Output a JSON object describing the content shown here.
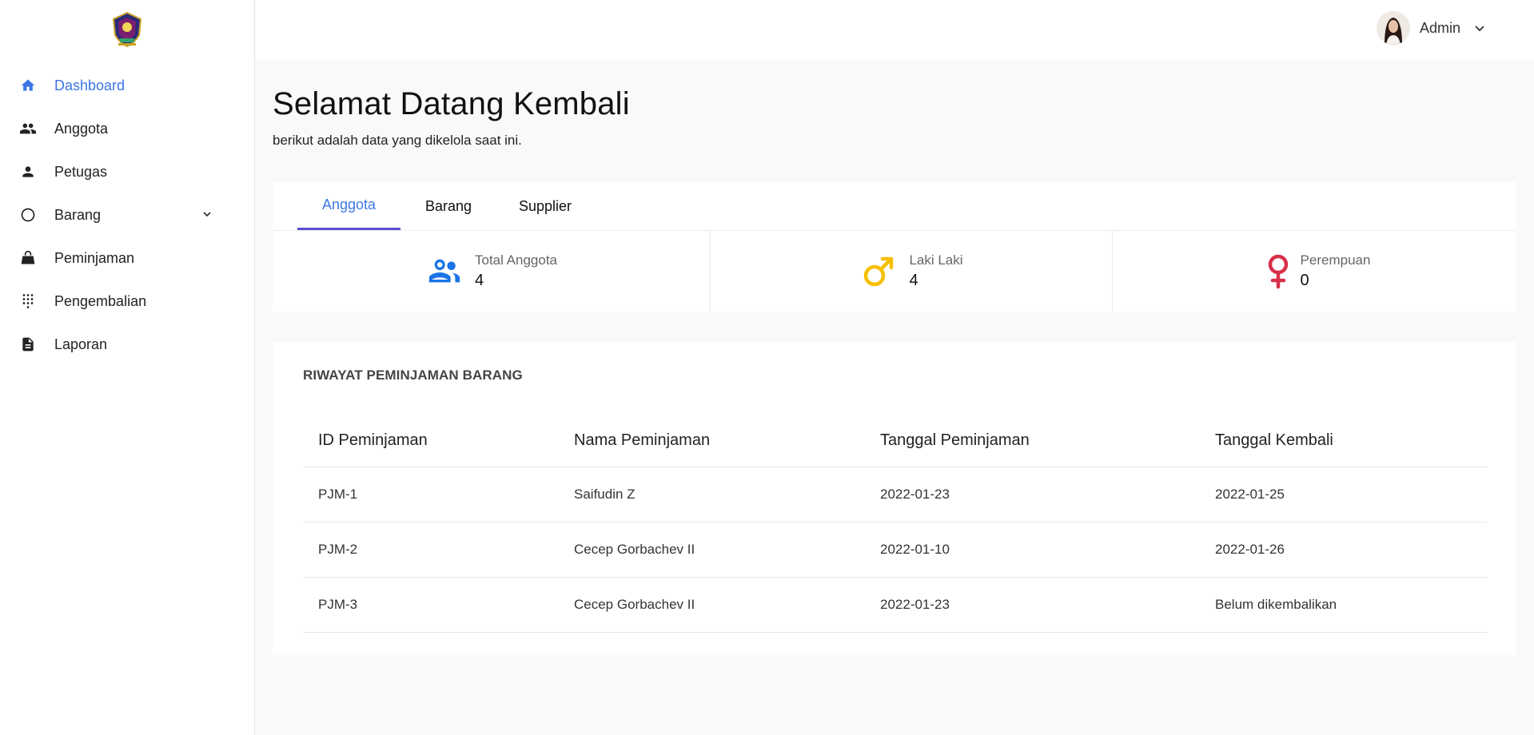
{
  "sidebar": {
    "logo_name": "institution-crest-logo",
    "items": [
      {
        "label": "Dashboard",
        "icon": "home-icon",
        "active": true
      },
      {
        "label": "Anggota",
        "icon": "people-icon"
      },
      {
        "label": "Petugas",
        "icon": "person-icon"
      },
      {
        "label": "Barang",
        "icon": "circle-icon",
        "expandable": true
      },
      {
        "label": "Peminjaman",
        "icon": "bag-icon"
      },
      {
        "label": "Pengembalian",
        "icon": "dial-pad-icon"
      },
      {
        "label": "Laporan",
        "icon": "document-icon"
      }
    ]
  },
  "header": {
    "user_name": "Admin"
  },
  "main": {
    "title": "Selamat Datang Kembali",
    "subtitle": "berikut adalah data yang dikelola saat ini.",
    "tabs": [
      {
        "label": "Anggota",
        "active": true
      },
      {
        "label": "Barang"
      },
      {
        "label": "Supplier"
      }
    ],
    "stats": [
      {
        "label": "Total Anggota",
        "value": "4",
        "icon": "people-icon",
        "color": "#1a73e8"
      },
      {
        "label": "Laki Laki",
        "value": "4",
        "icon": "male-icon",
        "color": "#f5c000"
      },
      {
        "label": "Perempuan",
        "value": "0",
        "icon": "female-icon",
        "color": "#d9304a"
      }
    ],
    "table": {
      "title": "RIWAYAT PEMINJAMAN BARANG",
      "headers": [
        "ID Peminjaman",
        "Nama Peminjaman",
        "Tanggal Peminjaman",
        "Tanggal Kembali"
      ],
      "rows": [
        [
          "PJM-1",
          "Saifudin Z",
          "2022-01-23",
          "2022-01-25"
        ],
        [
          "PJM-2",
          "Cecep Gorbachev II",
          "2022-01-10",
          "2022-01-26"
        ],
        [
          "PJM-3",
          "Cecep Gorbachev II",
          "2022-01-23",
          "Belum dikembalikan"
        ]
      ]
    }
  },
  "colors": {
    "accent": "#3c76e6",
    "tab_underline": "#5b4fd6",
    "background": "#f9f9f9"
  }
}
